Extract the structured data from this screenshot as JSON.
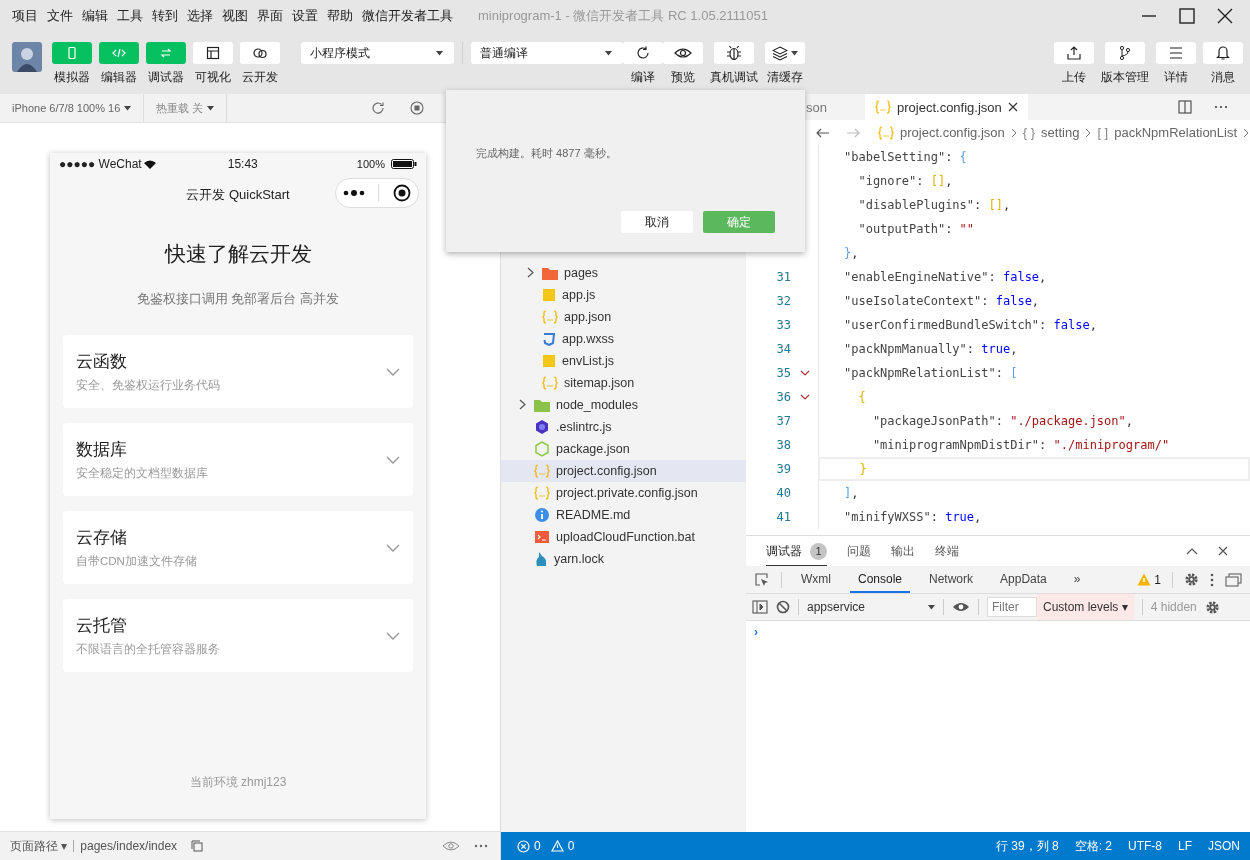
{
  "menu": [
    "项目",
    "文件",
    "编辑",
    "工具",
    "转到",
    "选择",
    "视图",
    "界面",
    "设置",
    "帮助",
    "微信开发者工具"
  ],
  "window": {
    "title": "miniprogram-1 - 微信开发者工具 RC 1.05.2111051"
  },
  "toolbar": {
    "modes": [
      {
        "label": "模拟器",
        "kind": "phone",
        "on": true
      },
      {
        "label": "编辑器",
        "kind": "code",
        "on": true
      },
      {
        "label": "调试器",
        "kind": "swap",
        "on": true
      },
      {
        "label": "可视化",
        "kind": "layout",
        "on": false
      },
      {
        "label": "云开发",
        "kind": "cloud",
        "on": false
      }
    ],
    "dropdowns": [
      {
        "value": "小程序模式"
      },
      {
        "value": "普通编译"
      }
    ],
    "actions": [
      {
        "label": "编译",
        "kind": "refresh",
        "caret": false
      },
      {
        "label": "预览",
        "kind": "eye",
        "caret": false
      },
      {
        "label": "真机调试",
        "kind": "bug",
        "caret": false
      },
      {
        "label": "清缓存",
        "kind": "layers",
        "caret": true
      }
    ],
    "right_actions": [
      {
        "label": "上传",
        "kind": "upload"
      },
      {
        "label": "版本管理",
        "kind": "branch"
      },
      {
        "label": "详情",
        "kind": "lines"
      },
      {
        "label": "消息",
        "kind": "bell"
      }
    ]
  },
  "simulator": {
    "device": "iPhone 6/7/8 100% 16",
    "hot_reload": "热重载 关",
    "phone": {
      "carrier": "●●●●● WeChat",
      "time": "15:43",
      "battery": "100%",
      "nav_title": "云开发 QuickStart",
      "title": "快速了解云开发",
      "subtitle": "免鉴权接口调用 免部署后台 高并发",
      "cards": [
        {
          "title": "云函数",
          "desc": "安全、免鉴权运行业务代码"
        },
        {
          "title": "数据库",
          "desc": "安全稳定的文档型数据库"
        },
        {
          "title": "云存储",
          "desc": "自带CDN加速文件存储"
        },
        {
          "title": "云托管",
          "desc": "不限语言的全托管容器服务"
        }
      ],
      "footer": "当前环境 zhmj123"
    }
  },
  "file_tree": [
    {
      "children": [
        {
          "name": "pages",
          "kind": "folder",
          "color": "#f2673a",
          "expandable": true,
          "selected": false
        },
        {
          "name": "app.js",
          "kind": "js",
          "expandable": false,
          "selected": false
        },
        {
          "name": "app.json",
          "kind": "json",
          "expandable": false,
          "selected": false
        },
        {
          "name": "app.wxss",
          "kind": "css",
          "expandable": false,
          "selected": false
        },
        {
          "name": "envList.js",
          "kind": "js",
          "expandable": false,
          "selected": false
        },
        {
          "name": "sitemap.json",
          "kind": "json",
          "expandable": false,
          "selected": false
        }
      ]
    },
    {
      "name": "node_modules",
      "kind": "folder",
      "color": "#8bc34a",
      "expandable": true,
      "selected": false
    },
    {
      "name": ".eslintrc.js",
      "kind": "eslint",
      "expandable": false,
      "selected": false
    },
    {
      "name": "package.json",
      "kind": "node",
      "expandable": false,
      "selected": false
    },
    {
      "name": "project.config.json",
      "kind": "json",
      "expandable": false,
      "selected": true
    },
    {
      "name": "project.private.config.json",
      "kind": "json",
      "expandable": false,
      "selected": false
    },
    {
      "name": "README.md",
      "kind": "info",
      "expandable": false,
      "selected": false
    },
    {
      "name": "uploadCloudFunction.bat",
      "kind": "bat",
      "expandable": false,
      "selected": false
    },
    {
      "name": "yarn.lock",
      "kind": "yarn",
      "expandable": false,
      "selected": false
    }
  ],
  "editor": {
    "tabs": [
      {
        "label": "son",
        "selected": false
      },
      {
        "label": "project.config.json",
        "icon": true,
        "selected": true
      }
    ],
    "breadcrumb": [
      {
        "kind": "file",
        "text": "project.config.json"
      },
      {
        "kind": "object",
        "symbol": "{ }",
        "text": "setting"
      },
      {
        "kind": "array",
        "symbol": "[ ]",
        "text": "packNpmRelationList"
      }
    ],
    "lines": [
      {
        "tokens": [
          {
            "kind": "key",
            "text": "\"babelSetting\""
          },
          {
            "kind": "punct",
            "text": ": "
          },
          {
            "kind": "bracket_blue",
            "text": "{"
          }
        ]
      },
      {
        "tokens": [
          {
            "kind": "key",
            "text": "  \"ignore\""
          },
          {
            "kind": "punct",
            "text": ": "
          },
          {
            "kind": "bracket_gold",
            "text": "[]"
          },
          {
            "kind": "punct",
            "text": ","
          }
        ]
      },
      {
        "tokens": [
          {
            "kind": "key",
            "text": "  \"disablePlugins\""
          },
          {
            "kind": "punct",
            "text": ": "
          },
          {
            "kind": "bracket_gold",
            "text": "[]"
          },
          {
            "kind": "punct",
            "text": ","
          }
        ]
      },
      {
        "tokens": [
          {
            "kind": "key",
            "text": "  \"outputPath\""
          },
          {
            "kind": "punct",
            "text": ": "
          },
          {
            "kind": "string",
            "text": "\"\""
          }
        ]
      },
      {
        "tokens": [
          {
            "kind": "bracket_blue",
            "text": "}"
          },
          {
            "kind": "punct",
            "text": ","
          }
        ]
      },
      {
        "n": "31",
        "tokens": [
          {
            "kind": "key",
            "text": "\"enableEngineNative\""
          },
          {
            "kind": "punct",
            "text": ": "
          },
          {
            "kind": "keyword",
            "text": "false"
          },
          {
            "kind": "punct",
            "text": ","
          }
        ]
      },
      {
        "n": "32",
        "tokens": [
          {
            "kind": "key",
            "text": "\"useIsolateContext\""
          },
          {
            "kind": "punct",
            "text": ": "
          },
          {
            "kind": "keyword",
            "text": "false"
          },
          {
            "kind": "punct",
            "text": ","
          }
        ]
      },
      {
        "n": "33",
        "tokens": [
          {
            "kind": "key",
            "text": "\"userConfirmedBundleSwitch\""
          },
          {
            "kind": "punct",
            "text": ": "
          },
          {
            "kind": "keyword",
            "text": "false"
          },
          {
            "kind": "punct",
            "text": ","
          }
        ]
      },
      {
        "n": "34",
        "tokens": [
          {
            "kind": "key",
            "text": "\"packNpmManually\""
          },
          {
            "kind": "punct",
            "text": ": "
          },
          {
            "kind": "keyword",
            "text": "true"
          },
          {
            "kind": "punct",
            "text": ","
          }
        ]
      },
      {
        "n": "35",
        "fold": true,
        "tokens": [
          {
            "kind": "key",
            "text": "\"packNpmRelationList\""
          },
          {
            "kind": "punct",
            "text": ": "
          },
          {
            "kind": "bracket_blue",
            "text": "["
          }
        ]
      },
      {
        "n": "36",
        "fold": true,
        "tokens": [
          {
            "kind": "bracket_gold",
            "text": "  {"
          }
        ]
      },
      {
        "n": "37",
        "tokens": [
          {
            "kind": "key",
            "text": "    \"packageJsonPath\""
          },
          {
            "kind": "punct",
            "text": ": "
          },
          {
            "kind": "string",
            "text": "\"./package.json\""
          },
          {
            "kind": "punct",
            "text": ","
          }
        ]
      },
      {
        "n": "38",
        "tokens": [
          {
            "kind": "key",
            "text": "    \"miniprogramNpmDistDir\""
          },
          {
            "kind": "punct",
            "text": ": "
          },
          {
            "kind": "string",
            "text": "\"./miniprogram/\""
          }
        ]
      },
      {
        "n": "39",
        "current": true,
        "tokens": [
          {
            "kind": "bracket_gold",
            "text": "  }"
          }
        ]
      },
      {
        "n": "40",
        "tokens": [
          {
            "kind": "bracket_blue",
            "text": "]"
          },
          {
            "kind": "punct",
            "text": ","
          }
        ]
      },
      {
        "n": "41",
        "tokens": [
          {
            "kind": "key",
            "text": "\"minifyWXSS\""
          },
          {
            "kind": "punct",
            "text": ": "
          },
          {
            "kind": "keyword",
            "text": "true"
          },
          {
            "kind": "punct",
            "text": ","
          }
        ]
      }
    ]
  },
  "debug_panel": {
    "tabs": [
      {
        "label": "调试器",
        "badge": "1",
        "selected": true
      },
      {
        "label": "问题",
        "selected": false
      },
      {
        "label": "输出",
        "selected": false
      },
      {
        "label": "终端",
        "selected": false
      }
    ],
    "devtools_tabs": [
      {
        "label": "Wxml",
        "selected": false
      },
      {
        "label": "Console",
        "selected": true
      },
      {
        "label": "Network",
        "selected": false
      },
      {
        "label": "AppData",
        "selected": false
      },
      {
        "label": "»",
        "selected": false
      }
    ],
    "warnings": "1",
    "context": "appservice",
    "filter_placeholder": "Filter",
    "levels": "Custom levels ▾",
    "hidden": "4 hidden",
    "prompt": "›"
  },
  "dialog": {
    "message": "完成构建。耗时 4877 毫秒。",
    "buttons": [
      {
        "label": "取消",
        "primary": false
      },
      {
        "label": "确定",
        "primary": true
      }
    ]
  },
  "status_bar": {
    "path_label": "页面路径 ▾",
    "path": "pages/index/index",
    "problems": [
      {
        "kind": "error",
        "count": "0"
      },
      {
        "kind": "warning",
        "count": "0"
      }
    ],
    "items": [
      "行 39，列 8",
      "空格: 2",
      "UTF-8",
      "LF",
      "JSON"
    ]
  }
}
